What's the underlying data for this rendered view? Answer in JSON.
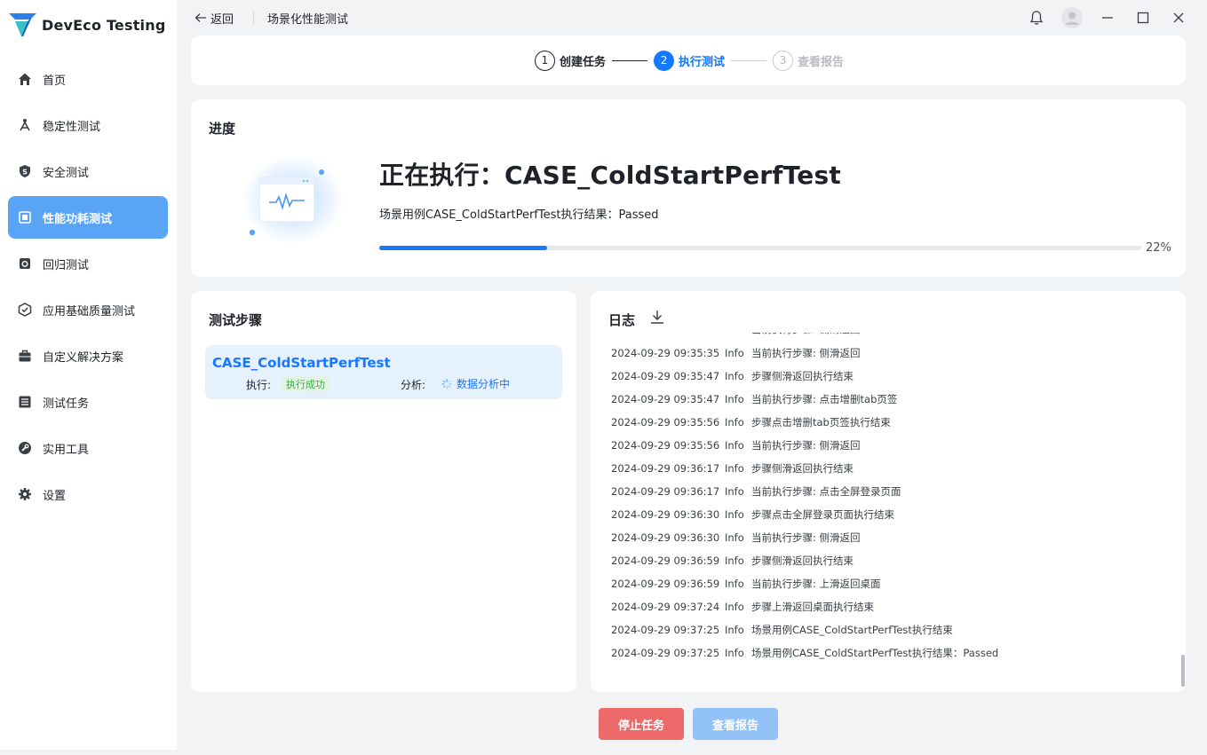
{
  "app": {
    "name": "DevEco Testing"
  },
  "sidebar": {
    "items": [
      {
        "label": "首页",
        "icon": "home-icon",
        "active": false
      },
      {
        "label": "稳定性测试",
        "icon": "stability-icon",
        "active": false
      },
      {
        "label": "安全测试",
        "icon": "security-icon",
        "active": false
      },
      {
        "label": "性能功耗测试",
        "icon": "performance-icon",
        "active": true
      },
      {
        "label": "回归测试",
        "icon": "regression-icon",
        "active": false
      },
      {
        "label": "应用基础质量测试",
        "icon": "quality-icon",
        "active": false
      },
      {
        "label": "自定义解决方案",
        "icon": "briefcase-icon",
        "active": false
      },
      {
        "label": "测试任务",
        "icon": "task-list-icon",
        "active": false
      },
      {
        "label": "实用工具",
        "icon": "wrench-icon",
        "active": false
      },
      {
        "label": "设置",
        "icon": "gear-icon",
        "active": false
      }
    ]
  },
  "topbar": {
    "back_label": "返回",
    "title": "场景化性能测试"
  },
  "stepper": {
    "steps": [
      {
        "num": "1",
        "label": "创建任务",
        "state": "done"
      },
      {
        "num": "2",
        "label": "执行测试",
        "state": "active"
      },
      {
        "num": "3",
        "label": "查看报告",
        "state": "pending"
      }
    ]
  },
  "progress": {
    "title": "进度",
    "executing": "正在执行：CASE_ColdStartPerfTest",
    "result": "场景用例CASE_ColdStartPerfTest执行结果：Passed",
    "percent": 22,
    "percent_label": "22%"
  },
  "test_steps": {
    "title": "测试步骤",
    "case_name": "CASE_ColdStartPerfTest",
    "exec_label": "执行:",
    "exec_status": "执行成功",
    "analysis_label": "分析:",
    "analysis_status": "数据分析中"
  },
  "log": {
    "title": "日志",
    "rows": [
      {
        "time": "2024-09-29 09:35:35",
        "level": "Info",
        "msg": "当前执行步骤: 侧滑返回"
      },
      {
        "time": "2024-09-29 09:35:47",
        "level": "Info",
        "msg": "步骤侧滑返回执行结束"
      },
      {
        "time": "2024-09-29 09:35:47",
        "level": "Info",
        "msg": "当前执行步骤: 点击增删tab页签"
      },
      {
        "time": "2024-09-29 09:35:56",
        "level": "Info",
        "msg": "步骤点击增删tab页签执行结束"
      },
      {
        "time": "2024-09-29 09:35:56",
        "level": "Info",
        "msg": "当前执行步骤: 侧滑返回"
      },
      {
        "time": "2024-09-29 09:36:17",
        "level": "Info",
        "msg": "步骤侧滑返回执行结束"
      },
      {
        "time": "2024-09-29 09:36:17",
        "level": "Info",
        "msg": "当前执行步骤: 点击全屏登录页面"
      },
      {
        "time": "2024-09-29 09:36:30",
        "level": "Info",
        "msg": "步骤点击全屏登录页面执行结束"
      },
      {
        "time": "2024-09-29 09:36:30",
        "level": "Info",
        "msg": "当前执行步骤: 侧滑返回"
      },
      {
        "time": "2024-09-29 09:36:59",
        "level": "Info",
        "msg": "步骤侧滑返回执行结束"
      },
      {
        "time": "2024-09-29 09:36:59",
        "level": "Info",
        "msg": "当前执行步骤: 上滑返回桌面"
      },
      {
        "time": "2024-09-29 09:37:24",
        "level": "Info",
        "msg": "步骤上滑返回桌面执行结束"
      },
      {
        "time": "2024-09-29 09:37:25",
        "level": "Info",
        "msg": "场景用例CASE_ColdStartPerfTest执行结束"
      },
      {
        "time": "2024-09-29 09:37:25",
        "level": "Info",
        "msg": "场景用例CASE_ColdStartPerfTest执行结果：Passed"
      }
    ]
  },
  "buttons": {
    "stop": "停止任务",
    "report": "查看报告"
  },
  "colors": {
    "accent": "#1677ff",
    "sidebar_active": "#5aa4f6",
    "danger": "#ee6a6a",
    "success": "#3aa845"
  }
}
